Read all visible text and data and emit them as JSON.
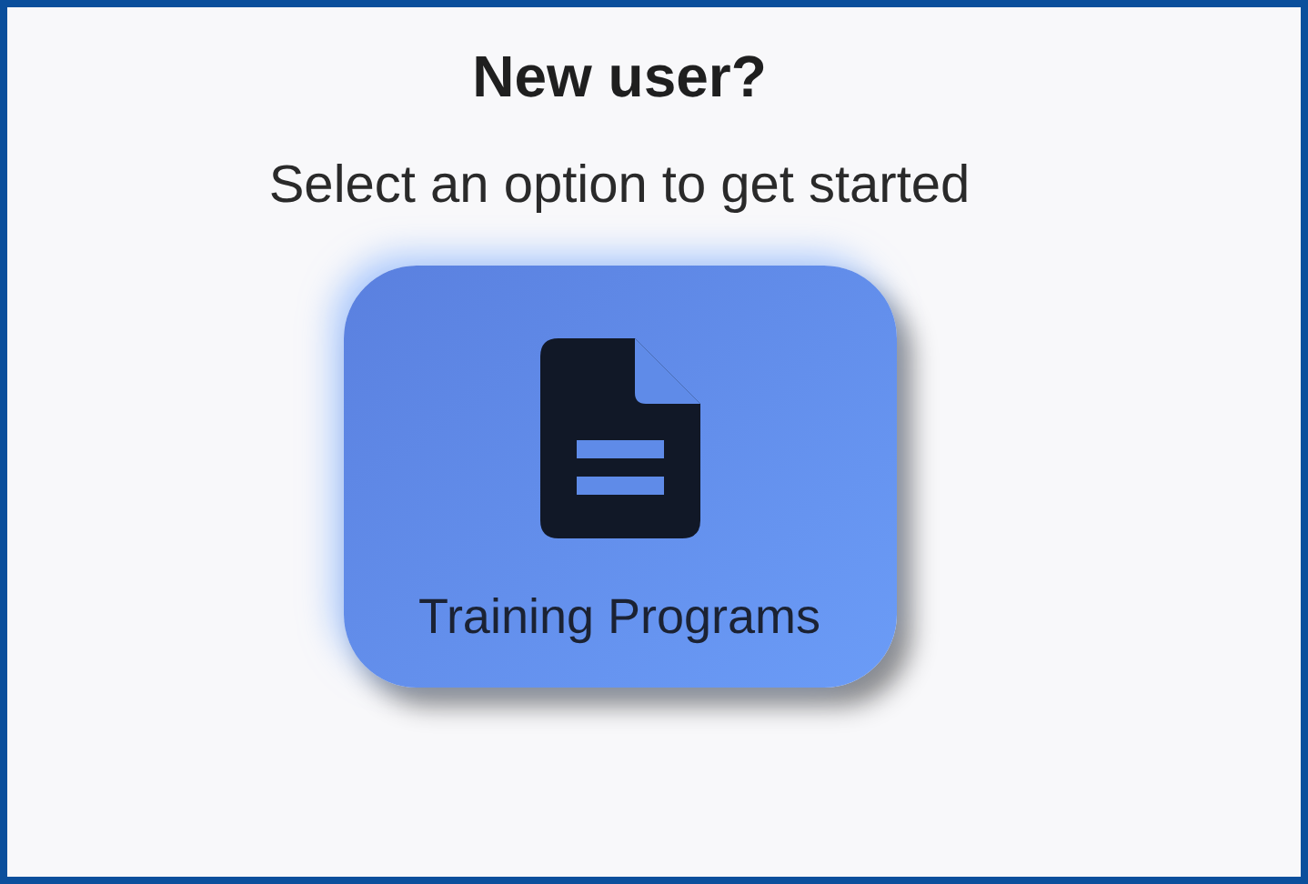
{
  "heading": "New user?",
  "subheading": "Select an option to get started",
  "options": [
    {
      "label": "Training Programs"
    }
  ]
}
